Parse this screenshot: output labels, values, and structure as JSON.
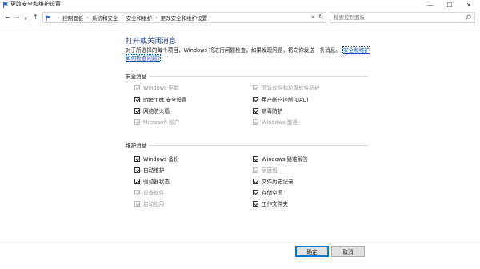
{
  "window": {
    "title": "更改安全和维护设置",
    "minimize": "—",
    "maximize": "☐",
    "close": "✕"
  },
  "nav": {
    "back": "←",
    "forward": "→",
    "recent": "∨",
    "up": "↑",
    "breadcrumbs": [
      "控制面板",
      "系统和安全",
      "安全和维护",
      "更改安全和维护设置"
    ],
    "separator": "›",
    "dropdown": "∨",
    "refresh": "↻",
    "search_placeholder": "搜索控制面板"
  },
  "main": {
    "title": "打开或关闭消息",
    "intro_text": "对于所选择的每个项目，Windows 将进行问题检查，如果发现问题，将向你发送一条消息。",
    "intro_link": "安全和维护如何检查问题?"
  },
  "security": {
    "heading": "安全消息",
    "items": [
      {
        "label": "Windows 更新",
        "checked": true,
        "enabled": false
      },
      {
        "label": "间谍软件和垃圾软件防护",
        "checked": true,
        "enabled": false
      },
      {
        "label": "Internet 安全设置",
        "checked": true,
        "enabled": true
      },
      {
        "label": "用户帐户控制(UAC)",
        "checked": true,
        "enabled": true
      },
      {
        "label": "网络防火墙",
        "checked": true,
        "enabled": true
      },
      {
        "label": "病毒防护",
        "checked": true,
        "enabled": true
      },
      {
        "label": "Microsoft 帐户",
        "checked": true,
        "enabled": false
      },
      {
        "label": "Windows 激活",
        "checked": true,
        "enabled": false
      }
    ]
  },
  "maintenance": {
    "heading": "维护消息",
    "items": [
      {
        "label": "Windows 备份",
        "checked": true,
        "enabled": true
      },
      {
        "label": "Windows 疑难解答",
        "checked": true,
        "enabled": true
      },
      {
        "label": "自动维护",
        "checked": true,
        "enabled": true
      },
      {
        "label": "家庭组",
        "checked": true,
        "enabled": false
      },
      {
        "label": "驱动器状态",
        "checked": true,
        "enabled": true
      },
      {
        "label": "文件历史记录",
        "checked": true,
        "enabled": true
      },
      {
        "label": "设备软件",
        "checked": true,
        "enabled": false
      },
      {
        "label": "存储空间",
        "checked": true,
        "enabled": true
      },
      {
        "label": "启动应用",
        "checked": true,
        "enabled": false
      },
      {
        "label": "工作文件夹",
        "checked": true,
        "enabled": true
      }
    ]
  },
  "footer": {
    "ok_label": "确定",
    "cancel_label": "取消"
  },
  "colors": {
    "title": "#1e3c8c",
    "link": "#1555b8",
    "focus": "#0078d7"
  }
}
